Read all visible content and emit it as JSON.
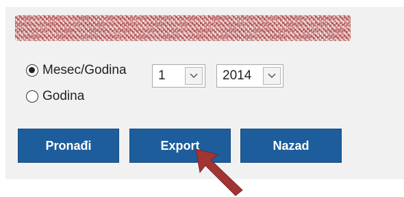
{
  "filters": {
    "radio_month_year": {
      "label": "Mesec/Godina",
      "checked": true
    },
    "radio_year": {
      "label": "Godina",
      "checked": false
    },
    "month_select": {
      "value": "1"
    },
    "year_select": {
      "value": "2014"
    }
  },
  "actions": {
    "find_label": "Pronađi",
    "export_label": "Export",
    "back_label": "Nazad"
  },
  "colors": {
    "button_bg": "#1d5d9b",
    "arrow": "#a23434",
    "panel_bg": "#f1f1f1"
  },
  "icons": {
    "dropdown": "chevron-down-icon",
    "pointer": "red-arrow-annotation"
  }
}
